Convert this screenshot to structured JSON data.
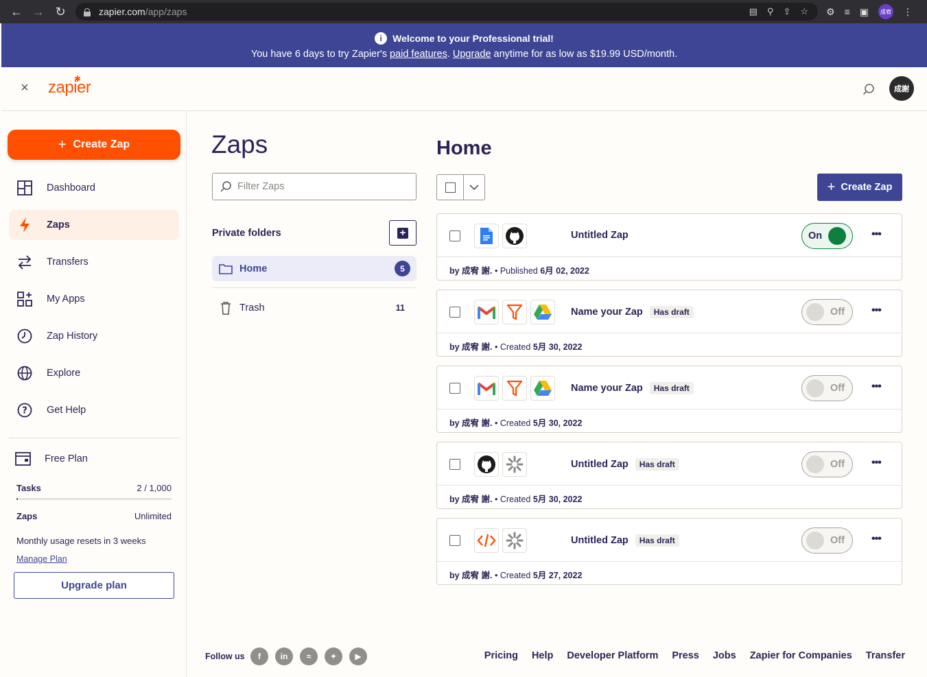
{
  "browser": {
    "url_host": "zapier.com",
    "url_path": "/app/zaps",
    "profile_initials": "成宥"
  },
  "banner": {
    "title": "Welcome to your Professional trial!",
    "text_before": "You have 6 days to try Zapier's ",
    "link_features": "paid features",
    "text_mid": ". ",
    "link_upgrade": "Upgrade",
    "text_after": " anytime for as low as $19.99 USD/month."
  },
  "header": {
    "logo": "zapier",
    "avatar_initials": "成謝"
  },
  "sidebar": {
    "create_label": "Create Zap",
    "items": [
      {
        "label": "Dashboard",
        "icon": "dashboard-icon"
      },
      {
        "label": "Zaps",
        "icon": "bolt-icon"
      },
      {
        "label": "Transfers",
        "icon": "transfer-icon"
      },
      {
        "label": "My Apps",
        "icon": "apps-icon"
      },
      {
        "label": "Zap History",
        "icon": "clock-icon"
      },
      {
        "label": "Explore",
        "icon": "globe-icon"
      },
      {
        "label": "Get Help",
        "icon": "help-icon"
      }
    ],
    "plan": {
      "name": "Free Plan",
      "tasks_label": "Tasks",
      "tasks_value": "2 / 1,000",
      "tasks_used": 2,
      "tasks_limit": 1000,
      "zaps_label": "Zaps",
      "zaps_value": "Unlimited",
      "reset_note": "Monthly usage resets in 3 weeks",
      "manage_link": "Manage Plan",
      "upgrade_label": "Upgrade plan"
    }
  },
  "folders": {
    "title": "Zaps",
    "filter_placeholder": "Filter Zaps",
    "private_label": "Private folders",
    "items": [
      {
        "label": "Home",
        "count": "5"
      },
      {
        "label": "Trash",
        "count": "11"
      }
    ]
  },
  "main": {
    "title": "Home",
    "create_label": "Create Zap",
    "zaps": [
      {
        "name": "Untitled Zap",
        "draft": "",
        "status": "On",
        "by": "by 成宥 謝.",
        "action": "Published",
        "date": "6月 02, 2022",
        "apps": [
          "google-docs-icon",
          "github-icon"
        ]
      },
      {
        "name": "Name your Zap",
        "draft": "Has draft",
        "status": "Off",
        "by": "by 成宥 謝.",
        "action": "Created",
        "date": "5月 30, 2022",
        "apps": [
          "gmail-icon",
          "filter-icon",
          "google-drive-icon"
        ]
      },
      {
        "name": "Name your Zap",
        "draft": "Has draft",
        "status": "Off",
        "by": "by 成宥 謝.",
        "action": "Created",
        "date": "5月 30, 2022",
        "apps": [
          "gmail-icon",
          "filter-icon",
          "google-drive-icon"
        ]
      },
      {
        "name": "Untitled Zap",
        "draft": "Has draft",
        "status": "Off",
        "by": "by 成宥 謝.",
        "action": "Created",
        "date": "5月 30, 2022",
        "apps": [
          "github-icon",
          "schedule-icon"
        ]
      },
      {
        "name": "Untitled Zap",
        "draft": "Has draft",
        "status": "Off",
        "by": "by 成宥 謝.",
        "action": "Created",
        "date": "5月 27, 2022",
        "apps": [
          "code-icon",
          "schedule-icon"
        ]
      }
    ]
  },
  "footer": {
    "follow_label": "Follow us",
    "social": [
      "f",
      "in",
      "rss",
      "tw",
      "yt"
    ],
    "links": [
      "Pricing",
      "Help",
      "Developer Platform",
      "Press",
      "Jobs",
      "Zapier for Companies",
      "Transfer"
    ]
  },
  "colors": {
    "accent_orange": "#ff4f00",
    "brand_indigo": "#3d4594",
    "toggle_on": "#0d8040"
  }
}
